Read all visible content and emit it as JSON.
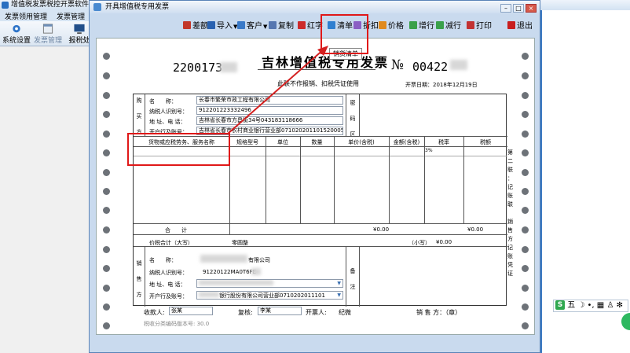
{
  "bg_app": {
    "title": "增值税发票税控开票软件（金税",
    "menu": [
      "发票领用管理",
      "发票管理"
    ],
    "tools": [
      "系统设置",
      "发票管理",
      "报税处"
    ]
  },
  "dialog": {
    "title": "开具增值税专用发票",
    "toolbar": [
      {
        "label": "差额",
        "icon": "diff-icon",
        "color": "#c2372a"
      },
      {
        "label": "导入",
        "icon": "import-icon",
        "color": "#2a62b0",
        "dropdown": true
      },
      {
        "label": "客户",
        "icon": "customer-icon",
        "color": "#3a7ac8",
        "dropdown": true
      },
      {
        "label": "复制",
        "icon": "copy-icon",
        "color": "#5677b0"
      },
      {
        "label": "红字",
        "icon": "red-invoice-icon",
        "color": "#cc2a2a"
      },
      {
        "label": "清单",
        "icon": "list-icon",
        "color": "#2f7fd0"
      },
      {
        "label": "折扣",
        "icon": "discount-icon",
        "color": "#8a5fc4"
      },
      {
        "label": "价格",
        "icon": "price-icon",
        "color": "#e08a1e"
      },
      {
        "label": "增行",
        "icon": "add-row-icon",
        "color": "#3aa04a"
      },
      {
        "label": "减行",
        "icon": "remove-row-icon",
        "color": "#3aa04a"
      },
      {
        "label": "打印",
        "icon": "print-icon",
        "color": "#c23232"
      },
      {
        "label": "退出",
        "icon": "exit-icon",
        "color": "#c81e1e"
      }
    ],
    "tooltip": "销货清单"
  },
  "invoice": {
    "code": "2200173",
    "title": "吉林增值税专用发票",
    "no_label": "№",
    "number": "00422",
    "notice": "此联不作报销、扣税凭证使用",
    "date_label": "开票日期：",
    "date": "2018年12月19日",
    "buyer": {
      "side_label": [
        "购",
        "买",
        "方"
      ],
      "name_label": "名　　称：",
      "name": "长春市繁荣市政工程有限公司",
      "tax_label": "纳税人识别号：",
      "tax_id": "912201223332496",
      "addr_label": "地 址、电 话：",
      "addr": "吉林省长春市方昌街34号043183118666",
      "bank_label": "开户行及账号：",
      "bank": "吉林省长春市农村商业银行营业部071020201101520005129"
    },
    "password_label": [
      "密",
      "码",
      "区"
    ],
    "columns": [
      "货物或应税劳务、服务名称",
      "规格型号",
      "单位",
      "数量",
      "单价(含税)",
      "金额(含税)",
      "税率",
      "税额"
    ],
    "row1_rate": "3%",
    "total_label": "合　　计",
    "total_amount": "¥0.00",
    "total_tax": "¥0.00",
    "grand_label": "价税合计（大写）",
    "grand_words": "零圆整",
    "grand_small_label": "（小写）",
    "grand_small": "¥0.00",
    "seller": {
      "side_label": [
        "销",
        "售",
        "方"
      ],
      "name_label": "名　　称：",
      "name": "有限公司",
      "tax_label": "纳税人识别号：",
      "tax_id": "91220122MA0T6FE",
      "addr_label": "地 址、电 话：",
      "bank_label": "开户行及账号：",
      "bank": "银行股份有限公司营业部0710202011101"
    },
    "remark_label": [
      "备",
      "注"
    ],
    "right_note": [
      "第",
      "二",
      "联",
      "：",
      "记",
      "账",
      "联",
      "　",
      "销",
      "售",
      "方",
      "记",
      "账",
      "凭",
      "证"
    ],
    "payee_label": "收款人:",
    "payee": "张某",
    "reviewer_label": "复核:",
    "reviewer": "李某",
    "drawer_label": "开票人:",
    "drawer": "纪微",
    "seller_stamp_label": "销 售 方：（章）",
    "bottom_note": "税收分类编码版本号: 30.0"
  },
  "ime": {
    "label": "五"
  }
}
